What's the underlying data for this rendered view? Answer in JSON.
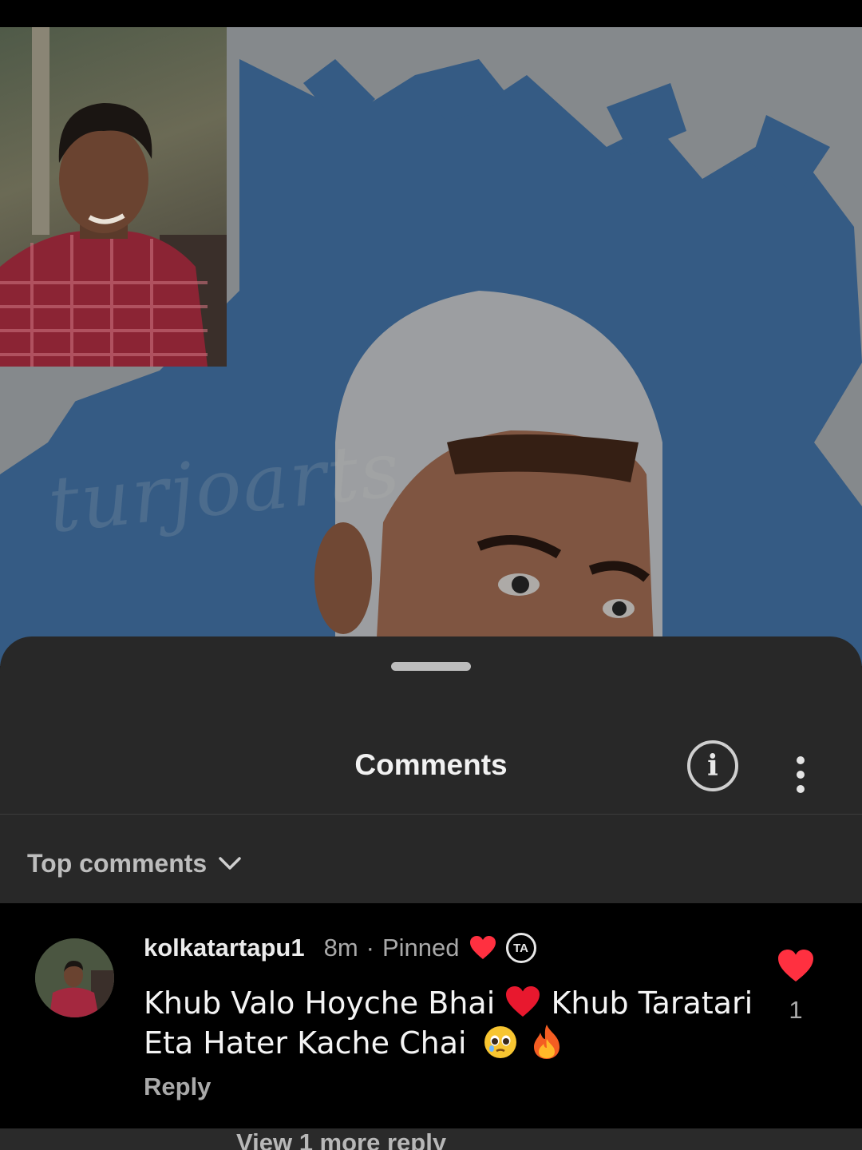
{
  "video": {
    "watermark": "turjoarts"
  },
  "sheet": {
    "title": "Comments",
    "sort_label": "Top comments"
  },
  "comment": {
    "username": "kolkatartapu1",
    "time": "8m",
    "separator": "·",
    "pinned": "Pinned",
    "badge": "TA",
    "text_part1": "Khub Valo Hoyche Bhai",
    "text_part2": "Khub Taratari Eta Hater Kache Chai",
    "reply_label": "Reply",
    "like_count": "1"
  },
  "replies": {
    "view_more": "View 1 more reply"
  },
  "colors": {
    "sheet_bg": "#282828",
    "heart": "#ff3040",
    "canvas_blue": "#4a7fb8"
  }
}
